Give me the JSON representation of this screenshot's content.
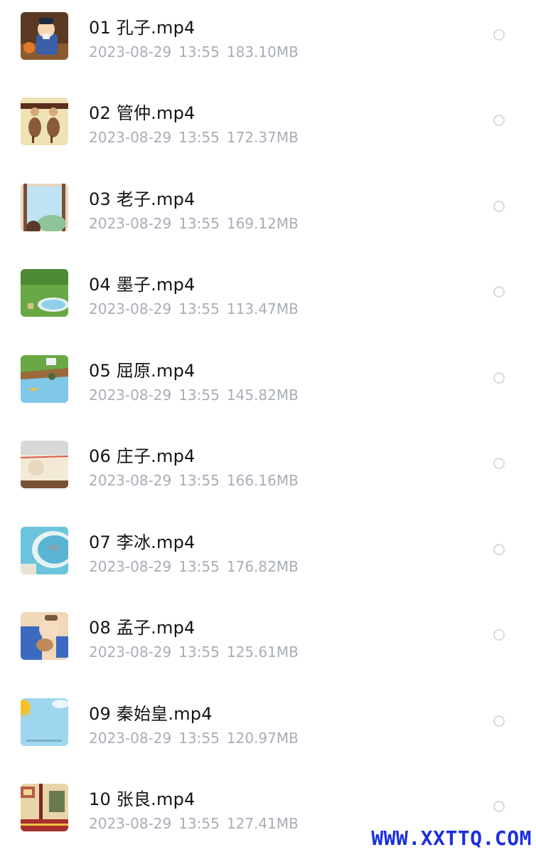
{
  "files": [
    {
      "name": "01 孔子.mp4",
      "date": "2023-08-29",
      "time": "13:55",
      "size": "183.10MB",
      "thumb": "portrait-scholar"
    },
    {
      "name": "02 管仲.mp4",
      "date": "2023-08-29",
      "time": "13:55",
      "size": "172.37MB",
      "thumb": "horses"
    },
    {
      "name": "03 老子.mp4",
      "date": "2023-08-29",
      "time": "13:55",
      "size": "169.12MB",
      "thumb": "window-sky"
    },
    {
      "name": "04 墨子.mp4",
      "date": "2023-08-29",
      "time": "13:55",
      "size": "113.47MB",
      "thumb": "green-field"
    },
    {
      "name": "05 屈原.mp4",
      "date": "2023-08-29",
      "time": "13:55",
      "size": "145.82MB",
      "thumb": "river-bank"
    },
    {
      "name": "06 庄子.mp4",
      "date": "2023-08-29",
      "time": "13:55",
      "size": "166.16MB",
      "thumb": "wall-sunset"
    },
    {
      "name": "07 李冰.mp4",
      "date": "2023-08-29",
      "time": "13:55",
      "size": "176.82MB",
      "thumb": "water-dam"
    },
    {
      "name": "08 孟子.mp4",
      "date": "2023-08-29",
      "time": "13:55",
      "size": "125.61MB",
      "thumb": "mother-child"
    },
    {
      "name": "09 秦始皇.mp4",
      "date": "2023-08-29",
      "time": "13:55",
      "size": "120.97MB",
      "thumb": "sunny-sky"
    },
    {
      "name": "10 张良.mp4",
      "date": "2023-08-29",
      "time": "13:55",
      "size": "127.41MB",
      "thumb": "palace-hall"
    }
  ],
  "watermark": "WWW.XXTTQ.COM",
  "colors": {
    "title": "#111418",
    "meta": "#a8adb8",
    "radio": "#d8dadf",
    "watermark": "#1b2fdc"
  }
}
